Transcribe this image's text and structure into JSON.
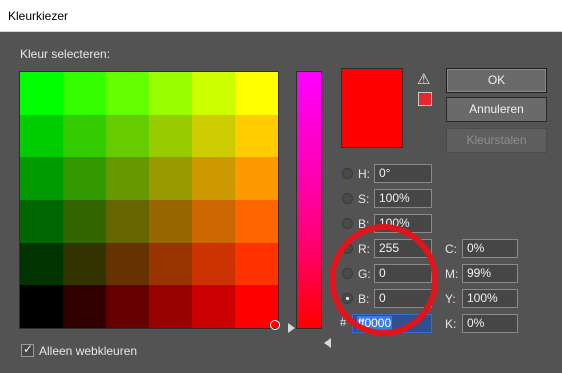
{
  "window": {
    "title": "Kleurkiezer"
  },
  "picker": {
    "label": "Kleur selecteren:",
    "grid_colors": [
      [
        "#00ff00",
        "#33ff00",
        "#66ff00",
        "#99ff00",
        "#ccff00",
        "#ffff00"
      ],
      [
        "#00cc00",
        "#33cc00",
        "#66cc00",
        "#99cc00",
        "#cccc00",
        "#ffcc00"
      ],
      [
        "#009900",
        "#339900",
        "#669900",
        "#999900",
        "#cc9900",
        "#ff9900"
      ],
      [
        "#006600",
        "#336600",
        "#666600",
        "#996600",
        "#cc6600",
        "#ff6600"
      ],
      [
        "#003300",
        "#333300",
        "#663300",
        "#993300",
        "#cc3300",
        "#ff3300"
      ],
      [
        "#000000",
        "#330000",
        "#660000",
        "#990000",
        "#cc0000",
        "#ff0000"
      ]
    ]
  },
  "preview": {
    "current_color": "#ff0000",
    "warning_icon": "⚠",
    "web_safe_color": "#e8262d"
  },
  "buttons": {
    "ok": "OK",
    "cancel": "Annuleren",
    "swatches": "Kleurstalen"
  },
  "fields": {
    "h": {
      "label": "H:",
      "value": "0°"
    },
    "s": {
      "label": "S:",
      "value": "100%"
    },
    "b_hsb": {
      "label": "B:",
      "value": "100%"
    },
    "r": {
      "label": "R:",
      "value": "255"
    },
    "g": {
      "label": "G:",
      "value": "0"
    },
    "b_rgb": {
      "label": "B:",
      "value": "0"
    },
    "c": {
      "label": "C:",
      "value": "0%"
    },
    "m": {
      "label": "M:",
      "value": "99%"
    },
    "y": {
      "label": "Y:",
      "value": "100%"
    },
    "k": {
      "label": "K:",
      "value": "0%"
    },
    "hex": {
      "label": "#",
      "value": "ff0000"
    }
  },
  "selected_radio": "b_rgb",
  "web_colors": {
    "label": "Alleen webkleuren",
    "checked": true,
    "check_glyph": "✓"
  },
  "annotation_color": "#e0151b"
}
